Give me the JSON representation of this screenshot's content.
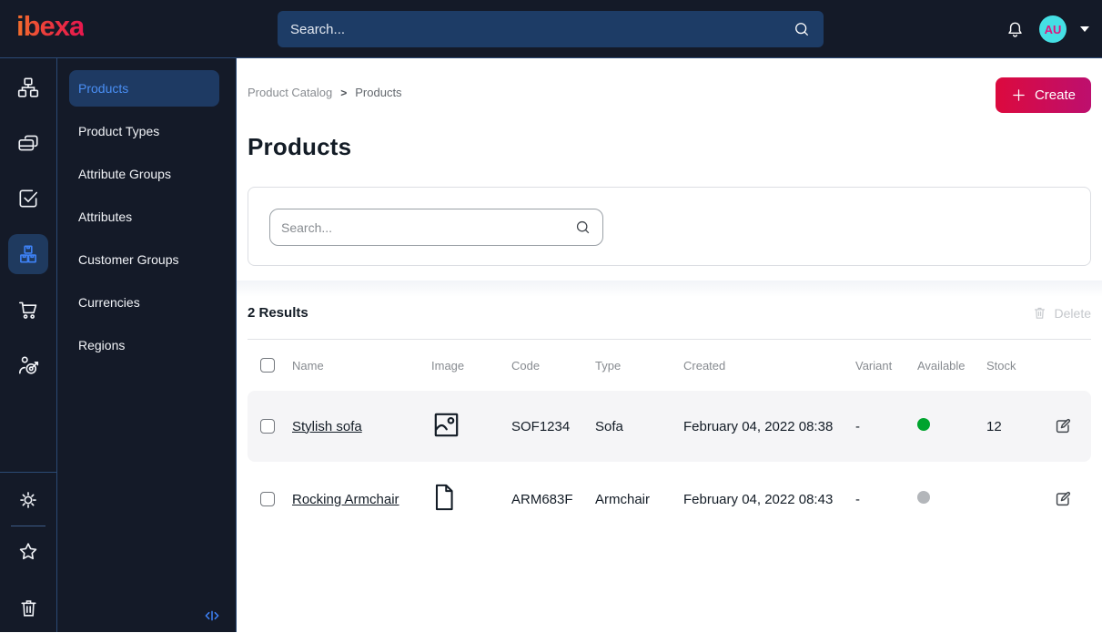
{
  "topbar": {
    "logo_text": "ibexa",
    "search_placeholder": "Search...",
    "avatar_initials": "AU"
  },
  "rail": {
    "icons": [
      "sitemap-icon",
      "pages-icon",
      "task-check-icon",
      "product-boxes-icon",
      "cart-icon",
      "personalization-target-icon"
    ],
    "bottom_icons": [
      "gear-icon",
      "star-icon",
      "trash-icon"
    ],
    "active_item": "product-boxes-icon"
  },
  "sidebar": {
    "items": [
      {
        "label": "Products",
        "active": true
      },
      {
        "label": "Product Types",
        "active": false
      },
      {
        "label": "Attribute Groups",
        "active": false
      },
      {
        "label": "Attributes",
        "active": false
      },
      {
        "label": "Customer Groups",
        "active": false
      },
      {
        "label": "Currencies",
        "active": false
      },
      {
        "label": "Regions",
        "active": false
      }
    ]
  },
  "main": {
    "breadcrumb": {
      "items": [
        "Product Catalog",
        "Products"
      ],
      "separator": ">"
    },
    "create_label": "Create",
    "title": "Products",
    "filter_search_placeholder": "Search...",
    "results_count_label": "2 Results",
    "delete_label": "Delete",
    "table": {
      "headers": [
        "Name",
        "Image",
        "Code",
        "Type",
        "Created",
        "Variant",
        "Available",
        "Stock"
      ],
      "rows": [
        {
          "name": "Stylish sofa",
          "image_icon": "image-icon",
          "code": "SOF1234",
          "type": "Sofa",
          "created": "February 04, 2022 08:38",
          "variant": "-",
          "available": true,
          "stock": "12"
        },
        {
          "name": "Rocking Armchair",
          "image_icon": "file-icon",
          "code": "ARM683F",
          "type": "Armchair",
          "created": "February 04, 2022 08:43",
          "variant": "-",
          "available": false,
          "stock": ""
        }
      ]
    }
  },
  "colors": {
    "topbar_bg": "#141a28",
    "divider_blue": "#2b4a75",
    "accent_blue": "#3e82f7",
    "active_pill_bg": "#1e3a63",
    "create_gradient_start": "#dc0a3e",
    "create_gradient_end": "#bd0f6e",
    "logo_gradient_start": "#f4702c",
    "logo_gradient_end": "#e8174e",
    "available_green": "#00a42e",
    "unavailable_gray": "#b3b6ba",
    "avatar_bg": "#45dfe4",
    "avatar_text": "#e0157e",
    "row_alt_bg": "#f5f5f7"
  }
}
